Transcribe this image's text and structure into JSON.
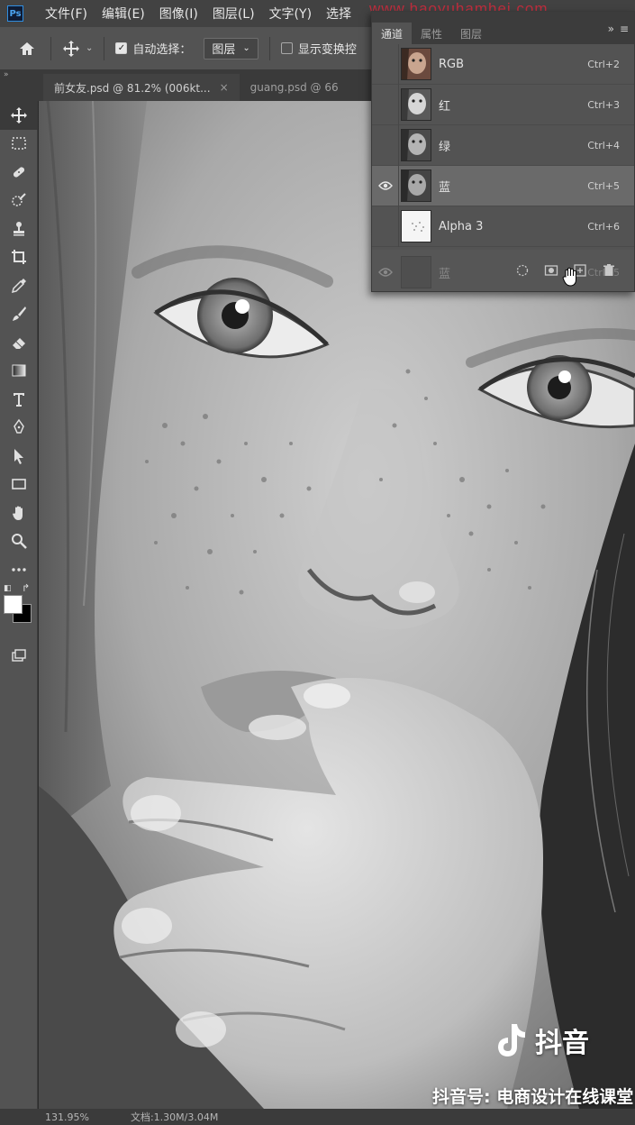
{
  "app": {
    "logo": "Ps"
  },
  "menu": [
    "文件(F)",
    "编辑(E)",
    "图像(I)",
    "图层(L)",
    "文字(Y)",
    "选择"
  ],
  "options": {
    "auto_select_label": "自动选择：",
    "auto_select_checked": true,
    "auto_select_target": "图层",
    "show_transform_label": "显示变换控",
    "show_transform_checked": false
  },
  "tabs": [
    {
      "label": "前女友.psd @ 81.2% (006kt..."
    },
    {
      "label": "guang.psd @ 66"
    }
  ],
  "panel": {
    "tabs": [
      "通道",
      "属性",
      "图层"
    ],
    "active_tab": "通道",
    "channels": [
      {
        "name": "RGB",
        "shortcut": "Ctrl+2",
        "visible": false,
        "selected": false
      },
      {
        "name": "红",
        "shortcut": "Ctrl+3",
        "visible": false,
        "selected": false
      },
      {
        "name": "绿",
        "shortcut": "Ctrl+4",
        "visible": false,
        "selected": false
      },
      {
        "name": "蓝",
        "shortcut": "Ctrl+5",
        "visible": true,
        "selected": true
      },
      {
        "name": "Alpha 3",
        "shortcut": "Ctrl+6",
        "visible": false,
        "selected": false
      }
    ],
    "dragging_channel": {
      "name": "蓝",
      "shortcut": "Ctrl+5"
    }
  },
  "status": {
    "zoom": "131.95%",
    "doc": "文档:1.30M/3.04M"
  },
  "watermark": {
    "top": "www.haoyuhamhei.com",
    "douyin": "抖音",
    "douyin_id": "抖音号: 电商设计在线课堂"
  },
  "colors": {
    "foreground": "#ffffff",
    "background": "#000000",
    "accent": "#2f8de0"
  }
}
